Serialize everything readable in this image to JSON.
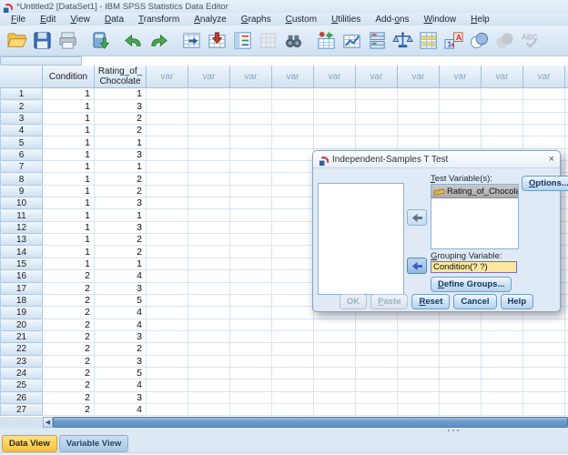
{
  "window": {
    "title": "*Untitled2 [DataSet1] - IBM SPSS Statistics Data Editor",
    "app_icon": "spss-logo-icon"
  },
  "menu": {
    "items": [
      {
        "text": "File",
        "accel": 0
      },
      {
        "text": "Edit",
        "accel": 0
      },
      {
        "text": "View",
        "accel": 0
      },
      {
        "text": "Data",
        "accel": 0
      },
      {
        "text": "Transform",
        "accel": 0
      },
      {
        "text": "Analyze",
        "accel": 0
      },
      {
        "text": "Graphs",
        "accel": 0
      },
      {
        "text": "Custom",
        "accel": 0
      },
      {
        "text": "Utilities",
        "accel": 0
      },
      {
        "text": "Add-ons",
        "accel": 4
      },
      {
        "text": "Window",
        "accel": 0
      },
      {
        "text": "Help",
        "accel": 0
      }
    ]
  },
  "toolbar": {
    "icons": [
      {
        "name": "open-data-icon",
        "disabled": false
      },
      {
        "name": "save-icon",
        "disabled": false
      },
      {
        "name": "print-icon",
        "disabled": false
      },
      {
        "name": "recall-dialogs-icon",
        "disabled": false
      },
      {
        "name": "undo-icon",
        "disabled": false
      },
      {
        "name": "redo-icon",
        "disabled": false
      },
      {
        "name": "goto-case-icon",
        "disabled": false
      },
      {
        "name": "goto-variable-icon",
        "disabled": false
      },
      {
        "name": "variables-icon",
        "disabled": false
      },
      {
        "name": "goto-imputation-icon",
        "disabled": true
      },
      {
        "name": "find-icon",
        "disabled": false
      },
      {
        "name": "insert-cases-icon",
        "disabled": false
      },
      {
        "name": "insert-variable-icon",
        "disabled": false
      },
      {
        "name": "split-file-icon",
        "disabled": false
      },
      {
        "name": "weight-cases-icon",
        "disabled": false
      },
      {
        "name": "select-cases-icon",
        "disabled": false
      },
      {
        "name": "value-labels-icon",
        "disabled": false
      },
      {
        "name": "use-variable-sets-icon",
        "disabled": false
      },
      {
        "name": "show-all-variables-icon",
        "disabled": true
      },
      {
        "name": "spell-check-icon",
        "disabled": true
      }
    ]
  },
  "cell_editor": {
    "reference": "",
    "value": ""
  },
  "grid": {
    "columns": {
      "condition": "Condition",
      "rating": "Rating_of_Chocolate",
      "var_placeholder": "var",
      "var_count": 11
    },
    "rows": [
      [
        1,
        1,
        1
      ],
      [
        2,
        1,
        3
      ],
      [
        3,
        1,
        2
      ],
      [
        4,
        1,
        2
      ],
      [
        5,
        1,
        1
      ],
      [
        6,
        1,
        3
      ],
      [
        7,
        1,
        1
      ],
      [
        8,
        1,
        2
      ],
      [
        9,
        1,
        2
      ],
      [
        10,
        1,
        3
      ],
      [
        11,
        1,
        1
      ],
      [
        12,
        1,
        3
      ],
      [
        13,
        1,
        2
      ],
      [
        14,
        1,
        2
      ],
      [
        15,
        1,
        1
      ],
      [
        16,
        2,
        4
      ],
      [
        17,
        2,
        3
      ],
      [
        18,
        2,
        5
      ],
      [
        19,
        2,
        4
      ],
      [
        20,
        2,
        4
      ],
      [
        21,
        2,
        3
      ],
      [
        22,
        2,
        2
      ],
      [
        23,
        2,
        3
      ],
      [
        24,
        2,
        5
      ],
      [
        25,
        2,
        4
      ],
      [
        26,
        2,
        3
      ],
      [
        27,
        2,
        4
      ]
    ]
  },
  "dialog": {
    "title": "Independent-Samples T Test",
    "close": "×",
    "test_variables_label": {
      "text": "Test Variable(s):",
      "accel": 0
    },
    "test_variables": [
      "Rating_of_Chocolate"
    ],
    "test_variable_icon": "scale-measure-icon",
    "grouping_label": {
      "text": "Grouping Variable:",
      "accel": 0
    },
    "grouping_value": "Condition(? ?)",
    "options_button": {
      "text": "Options...",
      "accel": 0
    },
    "define_groups_button": {
      "text": "Define Groups...",
      "accel": 0
    },
    "ok_button": "OK",
    "paste_button": {
      "text": "Paste",
      "accel": 0
    },
    "reset_button": {
      "text": "Reset",
      "accel": 0
    },
    "cancel_button": "Cancel",
    "help_button": "Help"
  },
  "tabs": [
    {
      "label": "Data View",
      "active": true
    },
    {
      "label": "Variable View",
      "active": false
    }
  ],
  "colors": {
    "active_tab": "#f6c23d",
    "grouping_field_bg": "#fce79e",
    "grouping_field_border": "#7c6fc0",
    "selected_item_bg": "#b5b5b5",
    "chrome_bg": "#dce8f4"
  }
}
